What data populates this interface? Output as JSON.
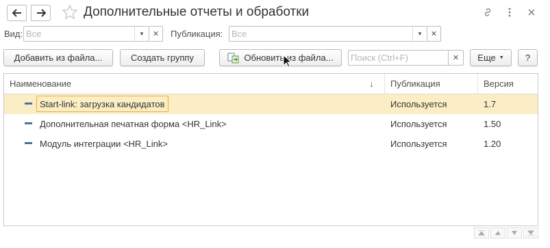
{
  "window": {
    "title": "Дополнительные отчеты и обработки",
    "nav_back": "back-arrow",
    "nav_forward": "forward-arrow"
  },
  "filters": {
    "kind_label": "Вид:",
    "kind_placeholder": "Все",
    "publication_label": "Публикация:",
    "publication_placeholder": "Все"
  },
  "toolbar": {
    "add_from_file": "Добавить из файла...",
    "create_group": "Создать группу",
    "update_from_file": "Обновить из файла...",
    "search_placeholder": "Поиск (Ctrl+F)",
    "more": "Еще",
    "help": "?"
  },
  "table": {
    "columns": [
      "Наименование",
      "Публикация",
      "Версия"
    ],
    "sort_indicator": "↓",
    "rows": [
      {
        "name": "Start-link: загрузка кандидатов",
        "publication": "Используется",
        "version": "1.7",
        "selected": true
      },
      {
        "name": "Дополнительная печатная форма <HR_Link>",
        "publication": "Используется",
        "version": "1.50",
        "selected": false
      },
      {
        "name": "Модуль интеграции <HR_Link>",
        "publication": "Используется",
        "version": "1.20",
        "selected": false
      }
    ]
  },
  "colors": {
    "selected_row": "#fbeec4",
    "focus_border": "#e6b03a",
    "item_icon": "#4b6f96"
  }
}
